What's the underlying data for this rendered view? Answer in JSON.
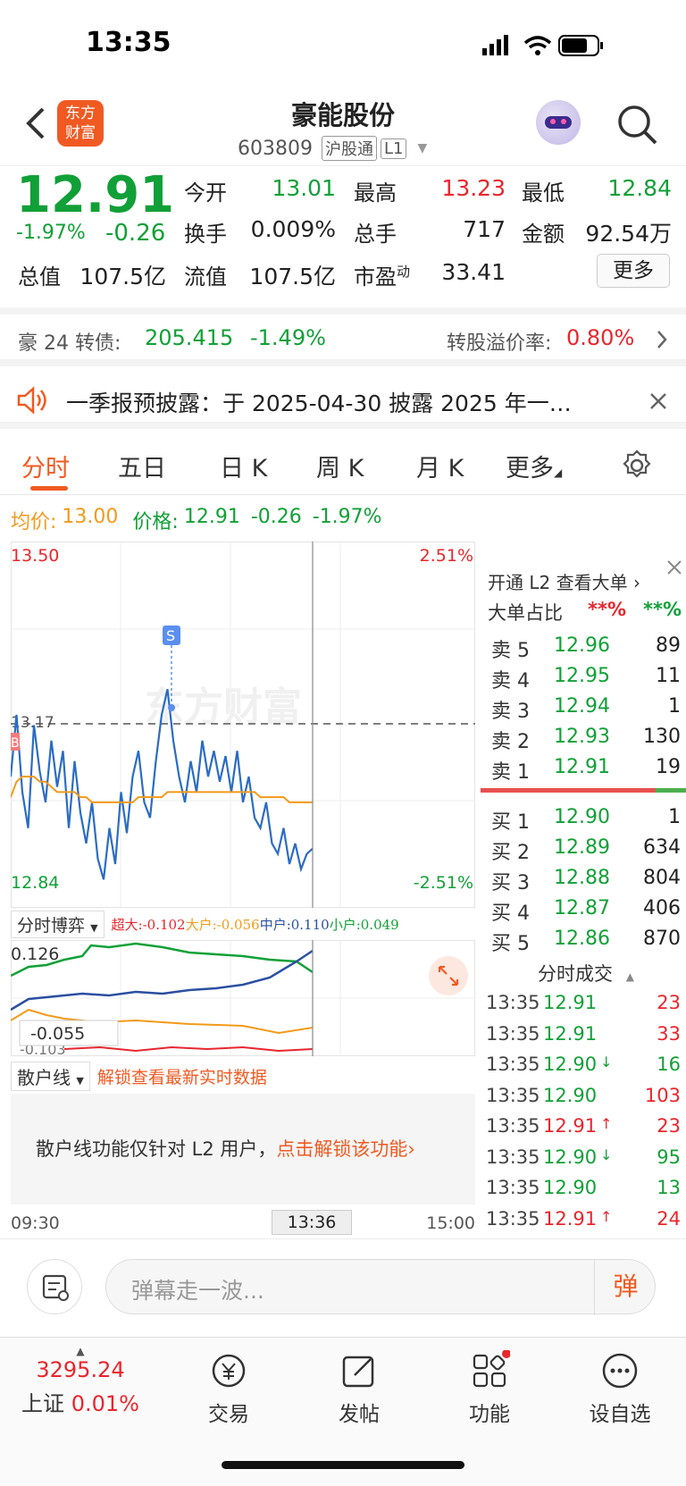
{
  "status_bar": {
    "time": "13:35"
  },
  "header": {
    "title": "豪能股份",
    "code": "603809",
    "market_tag": "沪股通",
    "level_tag": "L1",
    "logo_line1": "东方",
    "logo_line2": "财富"
  },
  "quote": {
    "price": "12.91",
    "change_pct": "-1.97%",
    "change": "-0.26",
    "open_label": "今开",
    "open": "13.01",
    "high_label": "最高",
    "high": "13.23",
    "low_label": "最低",
    "low": "12.84",
    "turnover_label": "换手",
    "turnover": "0.009%",
    "volume_label": "总手",
    "volume": "717",
    "amount_label": "金额",
    "amount": "92.54万",
    "mktcap_label": "总值",
    "mktcap": "107.5亿",
    "float_label": "流值",
    "float": "107.5亿",
    "pe_label": "市盈",
    "pe_sup": "动",
    "pe": "33.41",
    "more_button": "更多"
  },
  "bond": {
    "name": "豪 24 转债:",
    "price": "205.415",
    "change": "-1.49%",
    "premium_label": "转股溢价率:",
    "premium": "0.80%"
  },
  "notice": {
    "text": "一季报预披露：于 2025-04-30 披露 2025 年一…"
  },
  "tabs": [
    "分时",
    "五日",
    "日 K",
    "周 K",
    "月 K",
    "更多"
  ],
  "pricebar": {
    "avg_label": "均价:",
    "avg": "13.00",
    "price_label": "价格:",
    "price": "12.91",
    "change": "-0.26",
    "change_pct": "-1.97%"
  },
  "chart": {
    "y_top": "13.50",
    "y_bottom": "12.84",
    "pct_top": "2.51%",
    "pct_bottom": "-2.51%",
    "ref_line": "13.17",
    "marker_s": "S",
    "marker_b": "B",
    "watermark": "东方财富",
    "x_start": "09:30",
    "x_cursor": "13:36",
    "x_end": "15:00"
  },
  "chart_data": {
    "type": "line",
    "ylim": [
      12.84,
      13.5
    ],
    "series": [
      {
        "name": "价格",
        "values": [
          13.05,
          13.17,
          13.02,
          12.95,
          13.15,
          13.06,
          13.0,
          13.12,
          13.03,
          13.1,
          12.95,
          13.08,
          12.98,
          12.92,
          13.0,
          12.89,
          12.85,
          12.95,
          12.88,
          13.02,
          12.94,
          13.05,
          13.1,
          13.0,
          12.97,
          13.08,
          13.17,
          13.22,
          13.12,
          13.05,
          13.0,
          13.08,
          13.02,
          13.12,
          13.05,
          13.1,
          13.04,
          13.09,
          13.02,
          13.1,
          13.0,
          13.05,
          12.97,
          12.95,
          13.0,
          12.92,
          12.9,
          12.95,
          12.88,
          12.92,
          12.87,
          12.9,
          12.91
        ]
      },
      {
        "name": "均价",
        "values": [
          13.01,
          13.04,
          13.05,
          13.05,
          13.05,
          13.04,
          13.04,
          13.03,
          13.02,
          13.02,
          13.02,
          13.02,
          13.01,
          13.01,
          13.0,
          13.0,
          13.0,
          13.0,
          13.0,
          13.0,
          13.0,
          13.0,
          13.01,
          13.01,
          13.01,
          13.01,
          13.01,
          13.02,
          13.02,
          13.02,
          13.02,
          13.02,
          13.02,
          13.02,
          13.02,
          13.02,
          13.02,
          13.02,
          13.02,
          13.02,
          13.02,
          13.02,
          13.02,
          13.01,
          13.01,
          13.01,
          13.01,
          13.01,
          13.0,
          13.0,
          13.0,
          13.0,
          13.0
        ]
      }
    ]
  },
  "game": {
    "label": "分时博弈",
    "super_label": "超大:",
    "super": "-0.102",
    "large_label": "大户:",
    "large": "-0.056",
    "mid_label": "中户:",
    "mid": "0.110",
    "small_label": "小户:",
    "small": "0.049",
    "top_value": "0.126",
    "cursor_value": "-0.055",
    "low_value": "-0.103"
  },
  "retail": {
    "label": "散户线",
    "unlock_hint": "解锁查看最新实时数据",
    "msg": "散户线功能仅针对 L2 用户，",
    "msg_link": "点击解锁该功能"
  },
  "orderbook": {
    "l2_link": "开通 L2 查看大单",
    "big_label": "大单占比",
    "big_red": "**%",
    "big_green": "**%",
    "asks": [
      {
        "label": "卖 5",
        "price": "12.96",
        "vol": "89"
      },
      {
        "label": "卖 4",
        "price": "12.95",
        "vol": "11"
      },
      {
        "label": "卖 3",
        "price": "12.94",
        "vol": "1"
      },
      {
        "label": "卖 2",
        "price": "12.93",
        "vol": "130"
      },
      {
        "label": "卖 1",
        "price": "12.91",
        "vol": "19"
      }
    ],
    "bids": [
      {
        "label": "买 1",
        "price": "12.90",
        "vol": "1"
      },
      {
        "label": "买 2",
        "price": "12.89",
        "vol": "634"
      },
      {
        "label": "买 3",
        "price": "12.88",
        "vol": "804"
      },
      {
        "label": "买 4",
        "price": "12.87",
        "vol": "406"
      },
      {
        "label": "买 5",
        "price": "12.86",
        "vol": "870"
      }
    ],
    "trades_title": "分时成交",
    "trades": [
      {
        "time": "13:35",
        "price": "12.91",
        "arrow": "",
        "vol": "23",
        "color": "#e8262d"
      },
      {
        "time": "13:35",
        "price": "12.91",
        "arrow": "",
        "vol": "33",
        "color": "#e8262d"
      },
      {
        "time": "13:35",
        "price": "12.90",
        "arrow": "↓",
        "vol": "16",
        "color": "#11a037"
      },
      {
        "time": "13:35",
        "price": "12.90",
        "arrow": "",
        "vol": "103",
        "color": "#e8262d"
      },
      {
        "time": "13:35",
        "price": "12.91",
        "arrow": "↑",
        "vol": "23",
        "color": "#e8262d"
      },
      {
        "time": "13:35",
        "price": "12.90",
        "arrow": "↓",
        "vol": "95",
        "color": "#11a037"
      },
      {
        "time": "13:35",
        "price": "12.90",
        "arrow": "",
        "vol": "13",
        "color": "#11a037"
      },
      {
        "time": "13:35",
        "price": "12.91",
        "arrow": "↑",
        "vol": "24",
        "color": "#e8262d"
      }
    ]
  },
  "chat": {
    "placeholder": "弹幕走一波...",
    "danmu_button": "弹"
  },
  "tabbar": {
    "index_value": "3295.24",
    "index_name": "上证",
    "index_change": "0.01%",
    "items": [
      "交易",
      "发帖",
      "功能",
      "设自选"
    ]
  }
}
